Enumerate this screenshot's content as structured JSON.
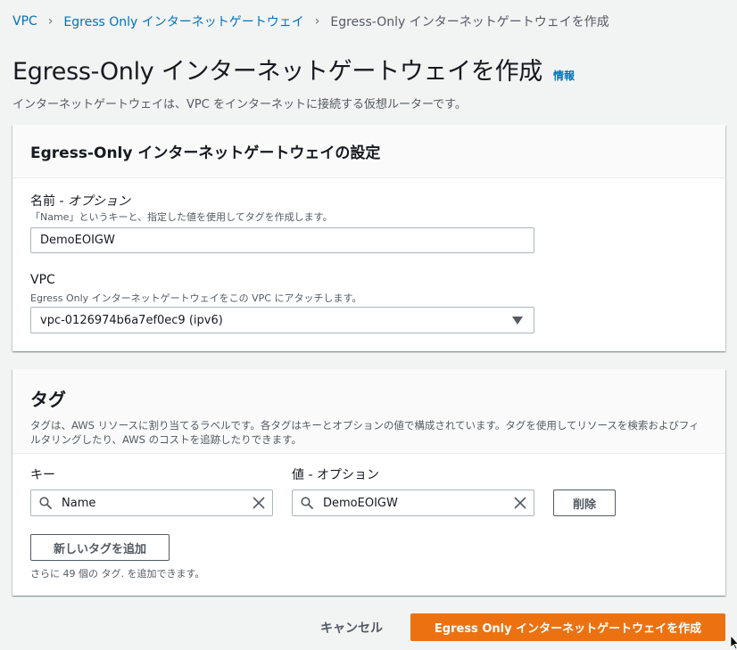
{
  "breadcrumb": {
    "items": [
      "VPC",
      "Egress Only インターネットゲートウェイ"
    ],
    "current": "Egress-Only インターネットゲートウェイを作成"
  },
  "header": {
    "title": "Egress-Only インターネットゲートウェイを作成",
    "info_link": "情報",
    "description": "インターネットゲートウェイは、VPC をインターネットに接続する仮想ルーターです。"
  },
  "settings": {
    "panel_title": "Egress-Only インターネットゲートウェイの設定",
    "name_label": "名前 - ",
    "name_label_optional": "オプション",
    "name_desc": "「Name」というキーと、指定した値を使用してタグを作成します。",
    "name_value": "DemoEOIGW",
    "vpc_label": "VPC",
    "vpc_desc": "Egress Only インターネットゲートウェイをこの VPC にアタッチします。",
    "vpc_selected": "vpc-0126974b6a7ef0ec9 (ipv6)"
  },
  "tags": {
    "title": "タグ",
    "description_line1": "タグは、AWS リソースに割り当てるラベルです。各タグはキーとオプションの値で構成されています。タグを使用してリソースを検索およびフィルタリングしたり、AWS のコストを追跡したりできます。",
    "key_header": "キー",
    "value_header": "値 - オプション",
    "rows": [
      {
        "key": "Name",
        "value": "DemoEOIGW"
      }
    ],
    "remove_label": "削除",
    "add_label": "新しいタグを追加",
    "limit_note": "さらに 49 個の タグ. を追加できます。"
  },
  "footer": {
    "cancel_label": "キャンセル",
    "create_label": "Egress Only インターネットゲートウェイを作成"
  },
  "colors": {
    "link": "#0073bb",
    "primary": "#ec7211",
    "background": "#f2f3f3"
  },
  "icons": [
    "search-icon",
    "clear-icon",
    "dropdown-caret-icon",
    "chevron-right-icon"
  ]
}
